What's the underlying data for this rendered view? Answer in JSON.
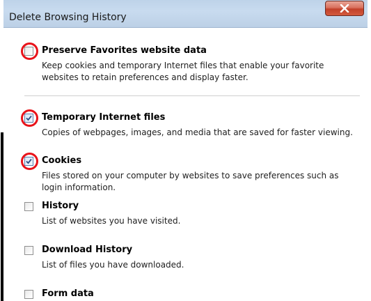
{
  "window": {
    "title": "Delete Browsing History",
    "close_glyph": "x"
  },
  "options": [
    {
      "title": "Preserve Favorites website data",
      "description": "Keep cookies and temporary Internet files that enable your favorite websites to retain preferences and display faster.",
      "checked": false,
      "highlighted": true
    },
    {
      "title": "Temporary Internet files",
      "description": "Copies of webpages, images, and media that are saved for faster viewing.",
      "checked": true,
      "highlighted": true
    },
    {
      "title": "Cookies",
      "description": "Files stored on your computer by websites to save preferences such as login information.",
      "checked": true,
      "highlighted": true
    },
    {
      "title": "History",
      "description": "List of websites you have visited.",
      "checked": false,
      "highlighted": false
    },
    {
      "title": "Download History",
      "description": "List of files you have downloaded.",
      "checked": false,
      "highlighted": false
    },
    {
      "title": "Form data",
      "description": "",
      "checked": false,
      "highlighted": false
    }
  ],
  "colors": {
    "highlight_circle": "#e8131a",
    "close_button": "#c2412a",
    "titlebar": "#c8dbef",
    "check_mark": "#2b4f86"
  }
}
